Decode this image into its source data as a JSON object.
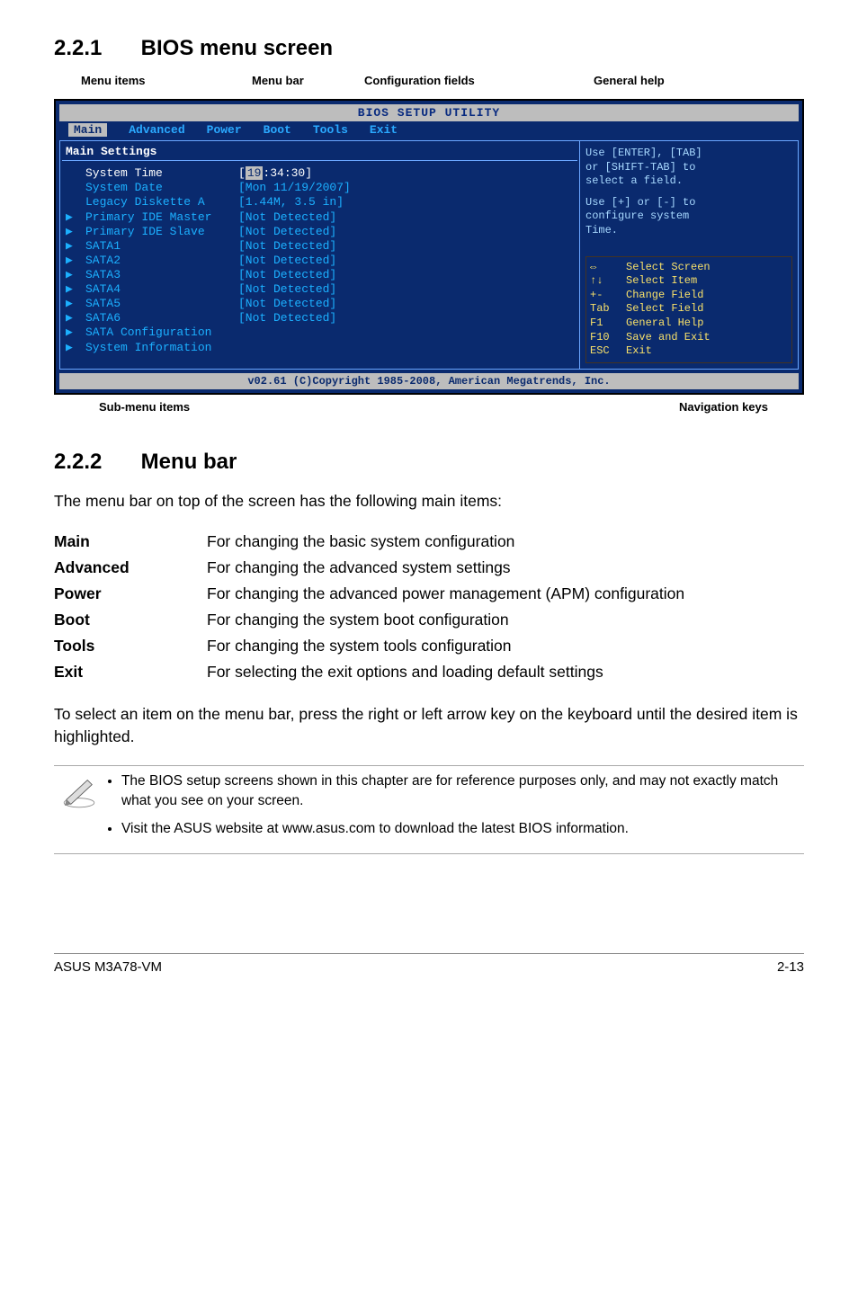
{
  "section1": {
    "number": "2.2.1",
    "title": "BIOS menu screen"
  },
  "diagram_labels": {
    "menu_items": "Menu items",
    "menu_bar": "Menu bar",
    "config_fields": "Configuration fields",
    "general_help": "General help",
    "sub_menu": "Sub-menu items",
    "nav_keys": "Navigation keys"
  },
  "bios": {
    "title": "BIOS SETUP UTILITY",
    "tabs": [
      "Main",
      "Advanced",
      "Power",
      "Boot",
      "Tools",
      "Exit"
    ],
    "active_tab": "Main",
    "settings_header": "Main Settings",
    "rows": [
      {
        "arrow": "",
        "label": "System Time",
        "value": "[19:34:30]",
        "selected": true,
        "highlight": true
      },
      {
        "arrow": "",
        "label": "System Date",
        "value": "[Mon 11/19/2007]"
      },
      {
        "arrow": "",
        "label": "Legacy Diskette A",
        "value": "[1.44M, 3.5 in]"
      },
      {
        "arrow": "",
        "label": "",
        "value": ""
      },
      {
        "arrow": "▶",
        "label": "Primary IDE Master",
        "value": "[Not Detected]"
      },
      {
        "arrow": "▶",
        "label": "Primary IDE Slave",
        "value": "[Not Detected]"
      },
      {
        "arrow": "▶",
        "label": "SATA1",
        "value": "[Not Detected]"
      },
      {
        "arrow": "▶",
        "label": "SATA2",
        "value": "[Not Detected]"
      },
      {
        "arrow": "▶",
        "label": "SATA3",
        "value": "[Not Detected]"
      },
      {
        "arrow": "▶",
        "label": "SATA4",
        "value": "[Not Detected]"
      },
      {
        "arrow": "▶",
        "label": "SATA5",
        "value": "[Not Detected]"
      },
      {
        "arrow": "▶",
        "label": "SATA6",
        "value": "[Not Detected]"
      },
      {
        "arrow": "▶",
        "label": "SATA Configuration",
        "value": ""
      },
      {
        "arrow": "",
        "label": "",
        "value": ""
      },
      {
        "arrow": "▶",
        "label": "System Information",
        "value": ""
      }
    ],
    "help": {
      "line1": "Use [ENTER], [TAB]",
      "line2": "or [SHIFT-TAB] to",
      "line3": "select a field.",
      "line4": "Use [+] or [-] to",
      "line5": "configure system",
      "line6": "Time."
    },
    "nav": [
      {
        "key": "⇔",
        "desc": "Select Screen"
      },
      {
        "key": "↑↓",
        "desc": "Select Item"
      },
      {
        "key": "+-",
        "desc": "Change Field"
      },
      {
        "key": "Tab",
        "desc": "Select Field"
      },
      {
        "key": "F1",
        "desc": "General Help"
      },
      {
        "key": "F10",
        "desc": "Save and Exit"
      },
      {
        "key": "ESC",
        "desc": "Exit"
      }
    ],
    "footer": "v02.61 (C)Copyright 1985-2008, American Megatrends, Inc."
  },
  "section2": {
    "number": "2.2.2",
    "title": "Menu bar",
    "intro": "The menu bar on top of the screen has the following main items:",
    "items": [
      {
        "term": "Main",
        "desc": "For changing the basic system configuration"
      },
      {
        "term": "Advanced",
        "desc": "For changing the advanced system settings"
      },
      {
        "term": "Power",
        "desc": "For changing the advanced power management (APM) configuration"
      },
      {
        "term": "Boot",
        "desc": "For changing the system boot configuration"
      },
      {
        "term": "Tools",
        "desc": "For changing the system tools configuration"
      },
      {
        "term": "Exit",
        "desc": "For selecting the exit options and loading default settings"
      }
    ],
    "outro": "To select an item on the menu bar, press the right or left arrow key on the keyboard until the desired item is highlighted."
  },
  "notes": [
    "The BIOS setup screens shown in this chapter are for reference purposes only, and may not exactly match what you see on your screen.",
    "Visit the ASUS website at www.asus.com to download the latest BIOS information."
  ],
  "footer": {
    "left": "ASUS M3A78-VM",
    "right": "2-13"
  }
}
